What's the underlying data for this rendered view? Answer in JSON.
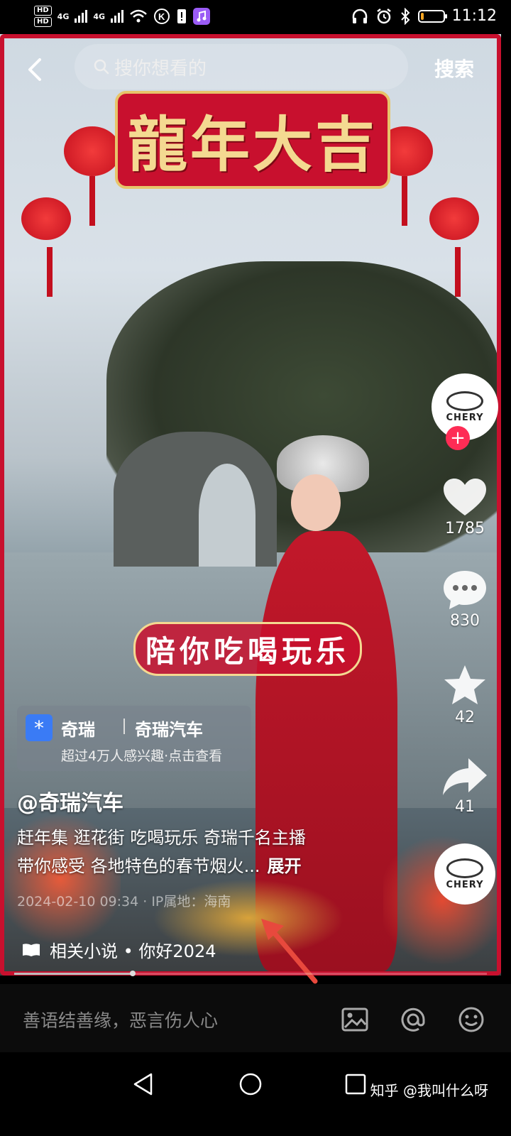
{
  "status_bar": {
    "hd1": "HD",
    "hd2": "HD",
    "net1": "4G",
    "net2": "4G",
    "time": "11:12",
    "battery_level_percent": 15
  },
  "top_bar": {
    "search_placeholder": "搜你想看的",
    "search_label": "搜索"
  },
  "video": {
    "banner_title": "龍年大吉",
    "caption_overlay": "陪你吃喝玩乐",
    "progress_fraction": 0.25
  },
  "actions": {
    "avatar_logo_text": "CHERY",
    "like_count": "1785",
    "comment_count": "830",
    "favorite_count": "42",
    "share_count": "41",
    "music_logo_text": "CHERY"
  },
  "ad_card": {
    "name": "奇瑞",
    "brand": "奇瑞汽车",
    "subtitle": "超过4万人感兴趣·点击查看"
  },
  "post": {
    "author": "@奇瑞汽车",
    "desc_line1": "赶年集 逛花街 吃喝玩乐 奇瑞千名主播",
    "desc_line2": "带你感受 各地特色的春节烟火...",
    "expand_label": "展开",
    "meta": "2024-02-10 09:34 · IP属地：海南",
    "related": "相关小说 • 你好2024"
  },
  "comment_bar": {
    "placeholder": "善语结善缘，恶言伤人心"
  },
  "watermark": "知乎 @我叫什么呀",
  "colors": {
    "frame_red": "#c8102e",
    "like_red": "#fe2c55",
    "ad_blue": "#3a7bf5"
  }
}
